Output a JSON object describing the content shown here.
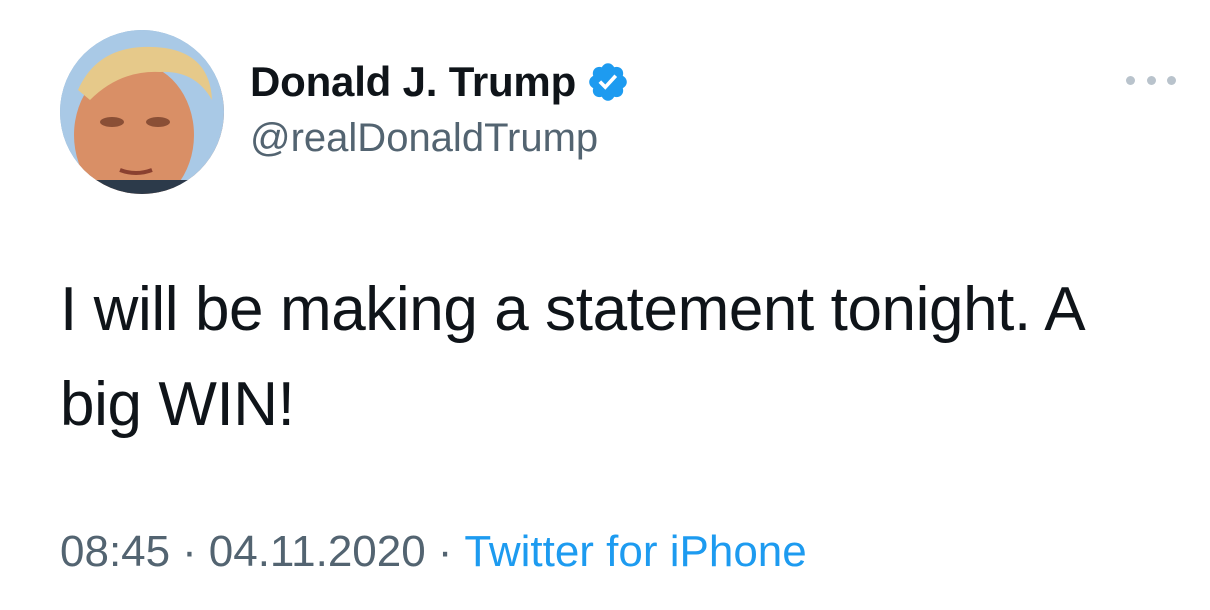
{
  "author": {
    "display_name": "Donald J. Trump",
    "handle": "@realDonaldTrump",
    "verified_icon": "verified-badge-icon",
    "verified_color": "#1d9bf0"
  },
  "menu": {
    "icon": "more-options-icon"
  },
  "tweet": {
    "text": "I will be making a statement tonight. A big WIN!",
    "time": "08:45",
    "separator": "·",
    "date": "04.11.2020",
    "source": "Twitter for iPhone"
  },
  "colors": {
    "text": "#0f1419",
    "muted": "#536471",
    "link": "#1d9bf0"
  }
}
